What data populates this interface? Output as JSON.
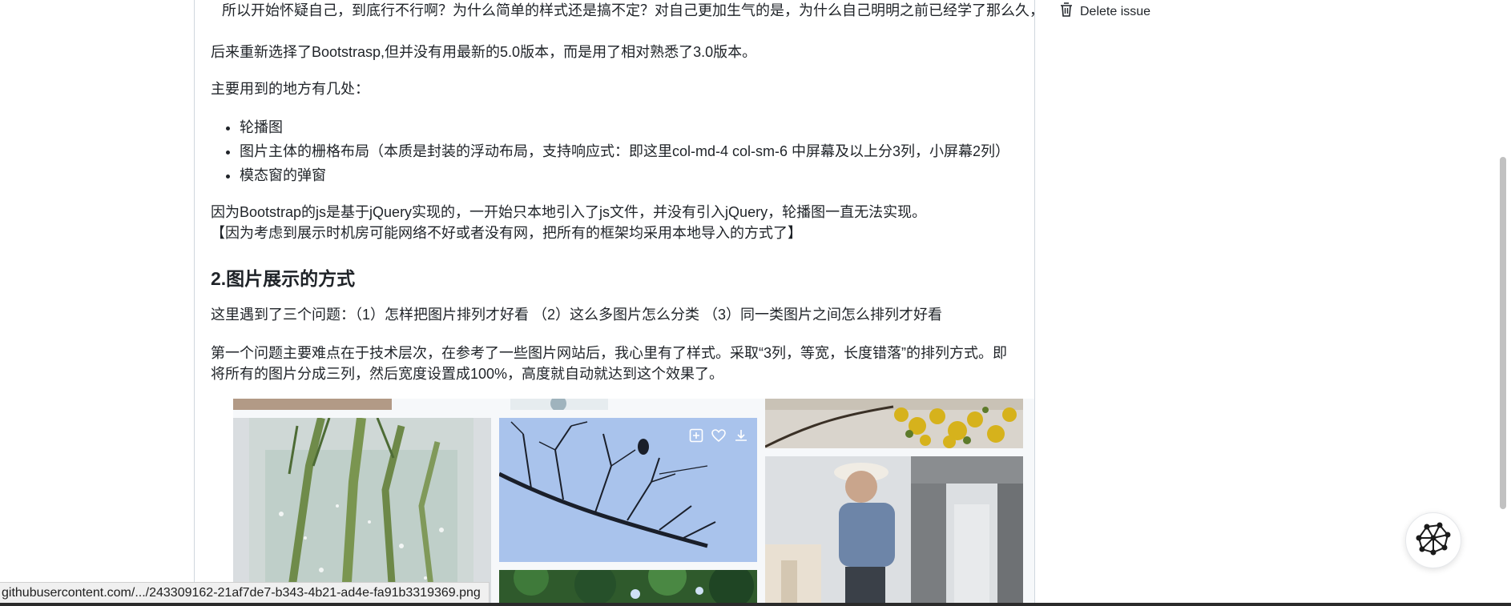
{
  "article": {
    "line_top": "所以开始怀疑自己，到底行不行啊？为什么简单的样式还是搞不定？对自己更加生气的是，为什么自己明明之前已经学了那么久，",
    "p1": "后来重新选择了Bootstrasp,但并没有用最新的5.0版本，而是用了相对熟悉了3.0版本。",
    "p2": "主要用到的地方有几处：",
    "list": [
      "轮播图",
      "图片主体的栅格布局（本质是封装的浮动布局，支持响应式：即这里col-md-4 col-sm-6 中屏幕及以上分3列，小屏幕2列）",
      "模态窗的弹窗"
    ],
    "p3_line1": "因为Bootstrap的js是基于jQuery实现的，一开始只本地引入了js文件，并没有引入jQuery，轮播图一直无法实现。",
    "p3_line2": "【因为考虑到展示时机房可能网络不好或者没有网，把所有的框架均采用本地导入的方式了】",
    "h2": "2.图片展示的方式",
    "p4": "这里遇到了三个问题：（1）怎样把图片排列才好看 （2）这么多图片怎么分类 （3）同一类图片之间怎么排列才好看",
    "p5": "第一个问题主要难点在于技术层次，在参考了一些图片网站后，我心里有了样式。采取“3列，等宽，长度错落”的排列方式。即将所有的图片分成三列，然后宽度设置成100%，高度就自动就达到这个效果了。"
  },
  "gallery": {
    "overlay_icons": [
      "add-to-collection-icon",
      "heart-icon",
      "download-icon"
    ]
  },
  "sidebar": {
    "delete_issue_label": "Delete issue"
  },
  "status_bar": {
    "url": "githubusercontent.com/.../243309162-21af7de7-b343-4b21-ad4e-fa91b3319369.png"
  },
  "colors": {
    "text": "#1f2328",
    "border": "#d0d7de",
    "sky": "#a9c3ec"
  }
}
